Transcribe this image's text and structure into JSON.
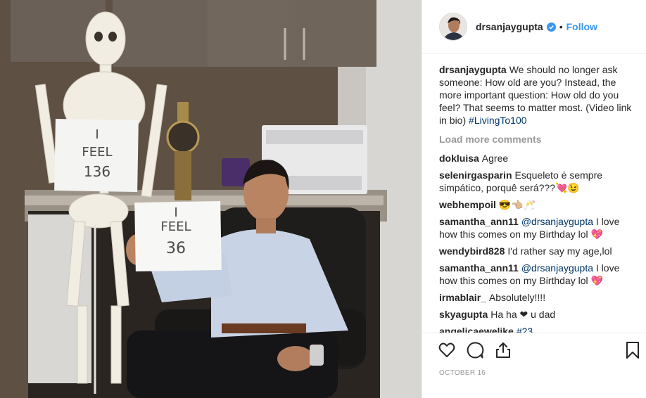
{
  "photo": {
    "sign_left": {
      "line1": "I",
      "line2": "FEEL",
      "line3": "136"
    },
    "sign_right": {
      "line1": "I",
      "line2": "FEEL",
      "line3": "36"
    }
  },
  "header": {
    "username": "drsanjaygupta",
    "separator": "•",
    "follow_label": "Follow"
  },
  "caption": {
    "username": "drsanjaygupta",
    "text": "We should no longer ask someone: How old are you? Instead, the more important question: How old do you feel? That seems to matter most. (Video link in bio) ",
    "hashtag": "#LivingTo100"
  },
  "load_more": "Load more comments",
  "comments": [
    {
      "user": "dokluisa",
      "text": "Agree"
    },
    {
      "user": "selenirgasparin",
      "text": "Esqueleto é sempre simpático, porquê será???💘😉"
    },
    {
      "user": "webhempoil",
      "text": "😎👈🏼🥂"
    },
    {
      "user": "samantha_ann11",
      "mention": "@drsanjaygupta",
      "text": " I love how this comes on my Birthday lol 💖"
    },
    {
      "user": "wendybird828",
      "text": "I'd rather say my age,lol"
    },
    {
      "user": "samantha_ann11",
      "mention": "@drsanjaygupta",
      "text": " I love how this comes on my Birthday lol 💖"
    },
    {
      "user": "irmablair_",
      "text": "Absolutely!!!!"
    },
    {
      "user": "skyagupta",
      "text": "Ha ha ❤ u dad"
    },
    {
      "user": "angelicaewelike",
      "hashtag": "#23"
    }
  ],
  "timestamp": "OCTOBER 16",
  "colors": {
    "accent": "#3897f0",
    "link": "#003569",
    "muted": "#999999",
    "text": "#262626"
  },
  "icons": [
    "verified-icon",
    "heart-icon",
    "comment-icon",
    "share-icon",
    "bookmark-icon"
  ]
}
